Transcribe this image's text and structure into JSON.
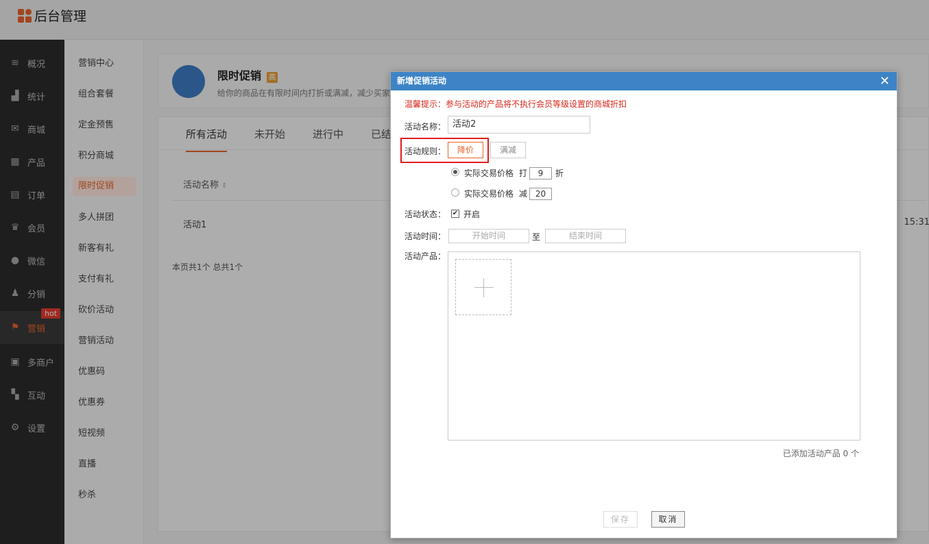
{
  "app": {
    "title": "后台管理"
  },
  "sidebar": {
    "items": [
      {
        "label": "概况",
        "icon": "layers-icon"
      },
      {
        "label": "统计",
        "icon": "chart-icon"
      },
      {
        "label": "商城",
        "icon": "mail-icon"
      },
      {
        "label": "产品",
        "icon": "grid-icon"
      },
      {
        "label": "订单",
        "icon": "clipboard-icon"
      },
      {
        "label": "会员",
        "icon": "crown-icon"
      },
      {
        "label": "微信",
        "icon": "chat-icon"
      },
      {
        "label": "分销",
        "icon": "users-icon"
      },
      {
        "label": "营销",
        "icon": "flag-icon",
        "badge": "hot"
      },
      {
        "label": "多商户",
        "icon": "store-icon"
      },
      {
        "label": "互动",
        "icon": "interact-icon"
      },
      {
        "label": "设置",
        "icon": "gear-icon"
      }
    ]
  },
  "subnav": {
    "items": [
      "营销中心",
      "组合套餐",
      "定金预售",
      "积分商城",
      "限时促销",
      "多人拼团",
      "新客有礼",
      "支付有礼",
      "砍价活动",
      "营销活动",
      "优惠码",
      "优惠券",
      "短视频",
      "直播",
      "秒杀"
    ]
  },
  "header": {
    "title": "限时促销",
    "badge": "高",
    "desc": "给你的商品在有限时间内打折或满减，减少买家"
  },
  "tabs": [
    "所有活动",
    "未开始",
    "进行中",
    "已结"
  ],
  "table": {
    "col_name": "活动名称",
    "rows": [
      {
        "name": "活动1",
        "time": "15:31"
      }
    ],
    "pager": "本页共1个 总共1个"
  },
  "dialog": {
    "title": "新增促销活动",
    "close": "✕",
    "tip": "温馨提示：参与活动的产品将不执行会员等级设置的商城折扣",
    "name_label": "活动名称：",
    "name_value": "活动2",
    "rule_label": "活动规则：",
    "rule_options": [
      "降价",
      "满减"
    ],
    "discount_text": "实际交易价格",
    "discount_prefix": "打",
    "discount_value": "9",
    "discount_suffix": "折",
    "reduce_text": "实际交易价格",
    "reduce_prefix": "减",
    "reduce_value": "20",
    "status_label": "活动状态：",
    "status_text": "开启",
    "time_label": "活动时间：",
    "start_placeholder": "开始时间",
    "time_sep": "至",
    "end_placeholder": "结束时间",
    "product_label": "活动产品：",
    "product_count": "已添加活动产品 0 个",
    "save": "保存",
    "cancel": "取消"
  },
  "colors": {
    "accent": "#e8642c",
    "dialog_header": "#3d84c6",
    "tip_red": "#d7271c"
  }
}
